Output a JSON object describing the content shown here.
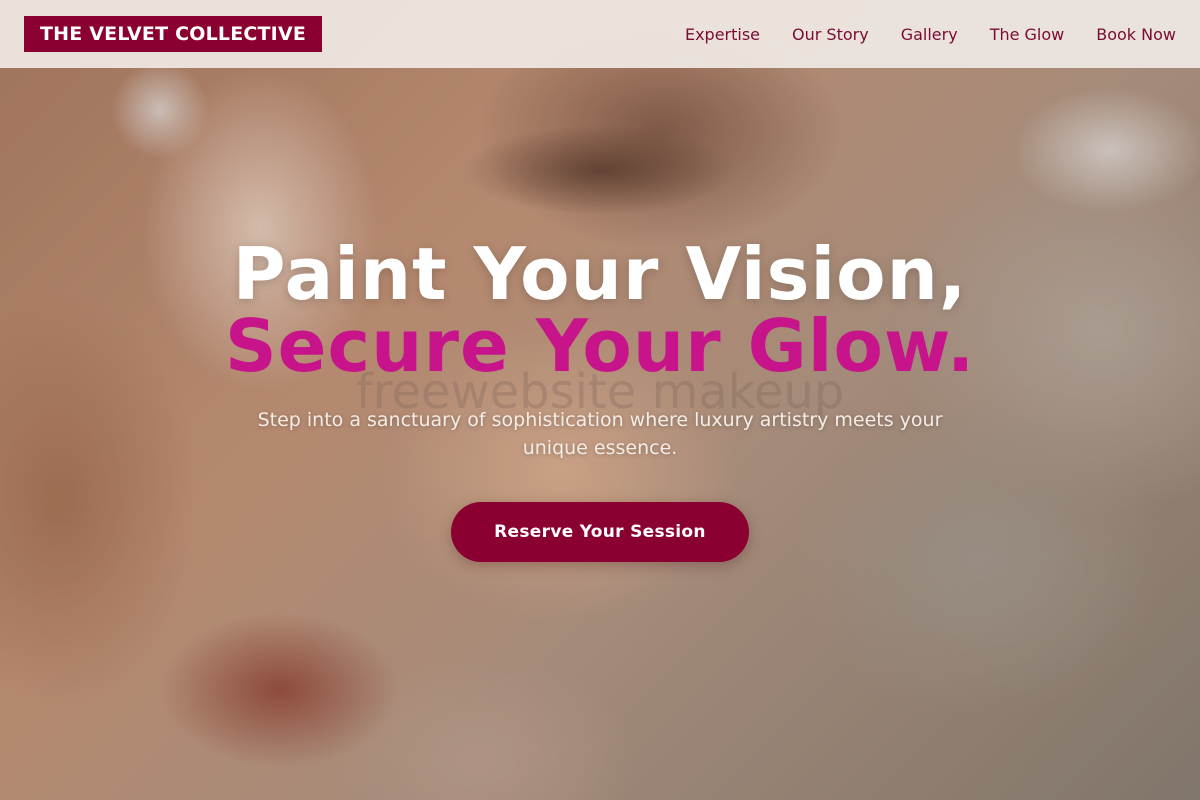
{
  "header": {
    "logo": "THE VELVET COLLECTIVE",
    "nav": [
      {
        "label": "Expertise"
      },
      {
        "label": "Our Story"
      },
      {
        "label": "Gallery"
      },
      {
        "label": "The Glow"
      },
      {
        "label": "Book Now"
      }
    ]
  },
  "hero": {
    "headline_line1": "Paint Your Vision,",
    "headline_line2": "Secure Your Glow.",
    "watermark": "freewebsite makeup",
    "subtitle": "Step into a sanctuary of sophistication where luxury artistry meets your unique essence.",
    "cta_label": "Reserve Your Session"
  },
  "colors": {
    "brand": "#8a0030",
    "accent": "#c8148a",
    "nav_text": "#7c0a33",
    "header_bg": "#eee8e2"
  }
}
